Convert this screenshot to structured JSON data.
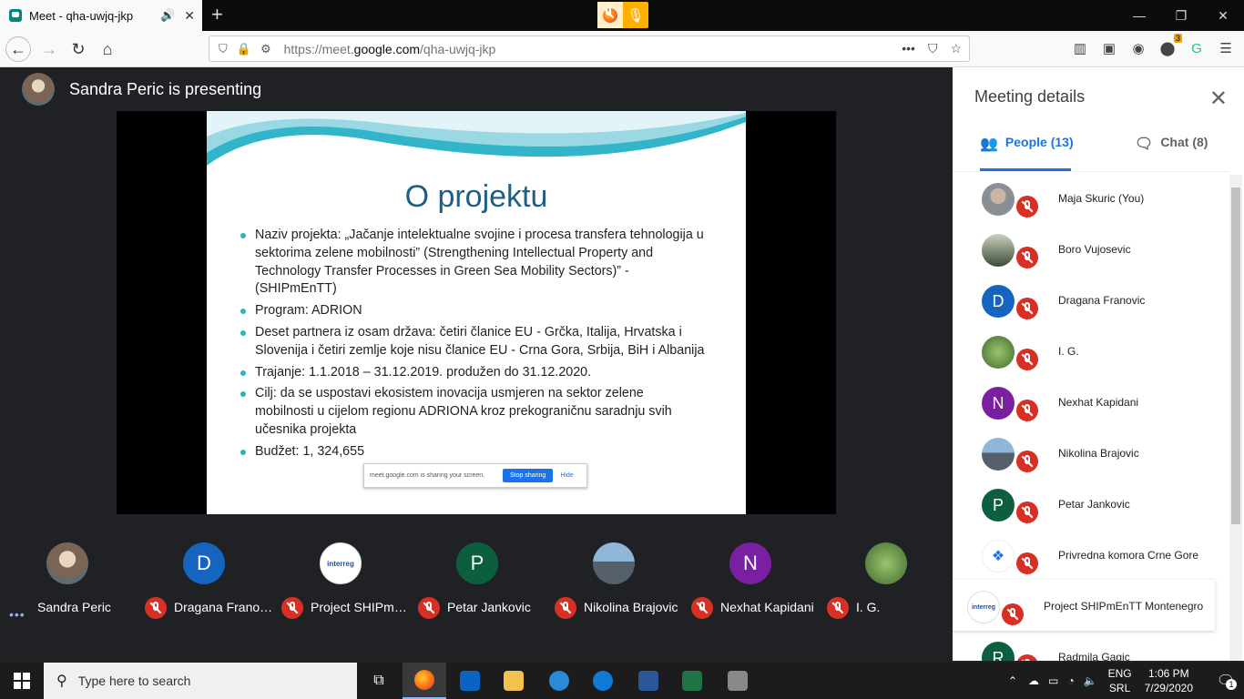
{
  "browser": {
    "tab_title": "Meet - qha-uwjq-jkp",
    "url_prefix": "https://meet.",
    "url_domain": "google.com",
    "url_path": "/qha-uwjq-jkp",
    "badge_count": "3"
  },
  "meet": {
    "presenting_text": "Sandra Peric is presenting",
    "slide": {
      "title": "O projektu",
      "bullets": [
        "Naziv projekta: „Jačanje intelektualne svojine i procesa transfera tehnologija u sektorima zelene mobilnosti” (Strengthening Intellectual Property and Technology Transfer Processes in Green Sea Mobility Sectors)” - (SHIPmEnTT)",
        "Program: ADRION",
        "Deset partnera iz osam država: četiri članice EU - Grčka, Italija, Hrvatska i Slovenija i četiri zemlje koje nisu članice EU - Crna Gora, Srbija, BiH i Albanija",
        "Trajanje: 1.1.2018 – 31.12.2019. produžen do 31.12.2020.",
        "Cilj: da se uspostavi ekosistem inovacija usmjeren na sektor zelene mobilnosti u cijelom regionu ADRIONA kroz prekograničnu saradnju svih učesnika projekta",
        "Budžet: 1, 324,655"
      ],
      "share_notice": "meet.google.com is sharing your screen.",
      "stop_label": "Stop sharing",
      "hide_label": "Hide"
    },
    "filmstrip": [
      {
        "name": "Sandra Peric",
        "initial": "",
        "color": "#5f6368"
      },
      {
        "name": "Dragana Franovic",
        "initial": "D",
        "color": "#1565c0"
      },
      {
        "name": "Project SHIPmEnTT Montenegro",
        "initial": "",
        "color": "#ffffff"
      },
      {
        "name": "Petar Jankovic",
        "initial": "P",
        "color": "#0b5f3f"
      },
      {
        "name": "Nikolina Brajovic",
        "initial": "",
        "color": "#6d7a86"
      },
      {
        "name": "Nexhat Kapidani",
        "initial": "N",
        "color": "#7b1fa2"
      },
      {
        "name": "I. G.",
        "initial": "",
        "color": "#4f7b3a"
      }
    ]
  },
  "panel": {
    "title": "Meeting details",
    "people_tab": "People (13)",
    "chat_tab": "Chat (8)",
    "people": [
      {
        "name": "Maja Skuric (You)",
        "initial": "",
        "color": "#8a8f95"
      },
      {
        "name": "Boro Vujosevic",
        "initial": "",
        "color": "#5b6b48"
      },
      {
        "name": "Dragana Franovic",
        "initial": "D",
        "color": "#1565c0"
      },
      {
        "name": "I. G.",
        "initial": "",
        "color": "#4f7b3a"
      },
      {
        "name": "Nexhat Kapidani",
        "initial": "N",
        "color": "#7b1fa2"
      },
      {
        "name": "Nikolina Brajovic",
        "initial": "",
        "color": "#6d7a86"
      },
      {
        "name": "Petar Jankovic",
        "initial": "P",
        "color": "#0b5f3f"
      },
      {
        "name": "Privredna komora Crne Gore",
        "initial": "",
        "color": "#ffffff"
      },
      {
        "name": "Project SHIPmEnTT Montenegro",
        "initial": "",
        "color": "#ffffff"
      },
      {
        "name": "Radmila Gagic",
        "initial": "R",
        "color": "#0b5f3f"
      }
    ]
  },
  "taskbar": {
    "search_placeholder": "Type here to search",
    "lang_1": "ENG",
    "lang_2": "SRL",
    "time": "1:06 PM",
    "date": "7/29/2020",
    "notif_count": "1"
  }
}
